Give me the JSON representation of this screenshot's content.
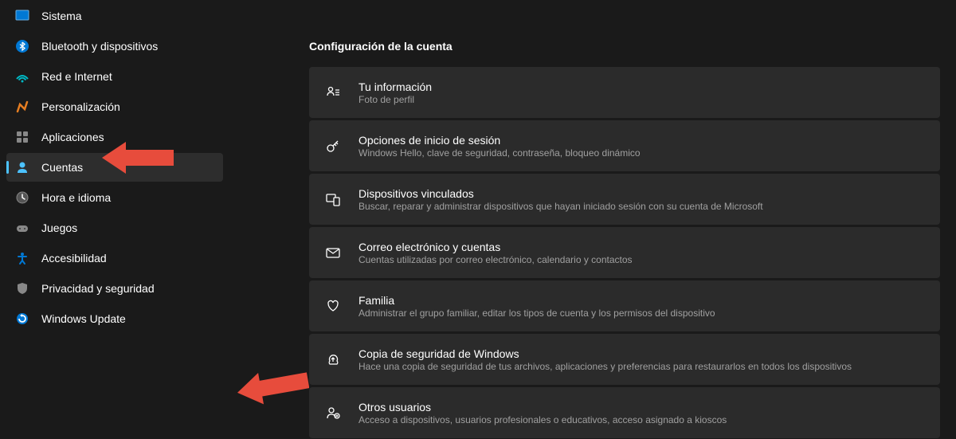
{
  "sidebar": {
    "items": [
      {
        "label": "Sistema",
        "icon": "system",
        "active": false
      },
      {
        "label": "Bluetooth y dispositivos",
        "icon": "bluetooth",
        "active": false
      },
      {
        "label": "Red e Internet",
        "icon": "network",
        "active": false
      },
      {
        "label": "Personalización",
        "icon": "personalization",
        "active": false
      },
      {
        "label": "Aplicaciones",
        "icon": "apps",
        "active": false
      },
      {
        "label": "Cuentas",
        "icon": "accounts",
        "active": true
      },
      {
        "label": "Hora e idioma",
        "icon": "time",
        "active": false
      },
      {
        "label": "Juegos",
        "icon": "gaming",
        "active": false
      },
      {
        "label": "Accesibilidad",
        "icon": "accessibility",
        "active": false
      },
      {
        "label": "Privacidad y seguridad",
        "icon": "privacy",
        "active": false
      },
      {
        "label": "Windows Update",
        "icon": "update",
        "active": false
      }
    ]
  },
  "section": {
    "title": "Configuración de la cuenta",
    "items": [
      {
        "label": "Tu información",
        "desc": "Foto de perfil",
        "icon": "info"
      },
      {
        "label": "Opciones de inicio de sesión",
        "desc": "Windows Hello, clave de seguridad, contraseña, bloqueo dinámico",
        "icon": "key"
      },
      {
        "label": "Dispositivos vinculados",
        "desc": "Buscar, reparar y administrar dispositivos que hayan iniciado sesión con su cuenta de Microsoft",
        "icon": "devices"
      },
      {
        "label": "Correo electrónico y cuentas",
        "desc": "Cuentas utilizadas por correo electrónico, calendario y contactos",
        "icon": "mail"
      },
      {
        "label": "Familia",
        "desc": "Administrar el grupo familiar, editar los tipos de cuenta y los permisos del dispositivo",
        "icon": "family"
      },
      {
        "label": "Copia de seguridad de Windows",
        "desc": "Hace una copia de seguridad de tus archivos, aplicaciones y preferencias para restaurarlos en todos los dispositivos",
        "icon": "backup"
      },
      {
        "label": "Otros usuarios",
        "desc": "Acceso a dispositivos, usuarios profesionales o educativos, acceso asignado a kioscos",
        "icon": "users"
      }
    ]
  }
}
